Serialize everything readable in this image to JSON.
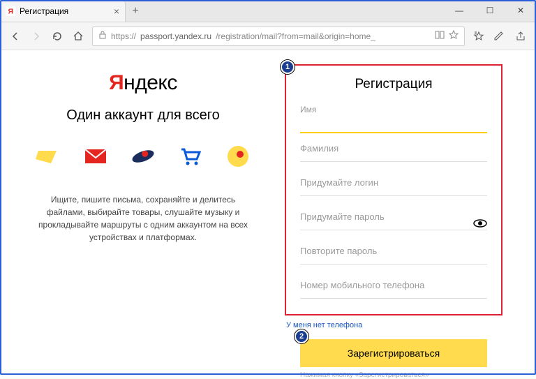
{
  "browser": {
    "tab_title": "Регистрация",
    "url_proto": "https://",
    "url_host": "passport.yandex.ru",
    "url_path": "/registration/mail?from=mail&origin=home_"
  },
  "left": {
    "logo_y": "Я",
    "logo_rest": "ндекс",
    "tagline": "Один аккаунт для всего",
    "desc": "Ищите, пишите письма, сохраняйте и делитесь файлами, выбирайте товары, слушайте музыку и прокладывайте маршруты с одним аккаунтом на всех устройствах и платформах."
  },
  "form": {
    "title": "Регистрация",
    "fields": {
      "first_name_label": "Имя",
      "last_name_label": "Фамилия",
      "login_label": "Придумайте логин",
      "password_label": "Придумайте пароль",
      "password_repeat_label": "Повторите пароль",
      "phone_label": "Номер мобильного телефона"
    },
    "no_phone_link": "У меня нет телефона",
    "submit": "Зарегистрироваться",
    "note": "Нажимая кнопку «Зарегистрироваться»"
  },
  "callouts": {
    "one": "1",
    "two": "2"
  }
}
